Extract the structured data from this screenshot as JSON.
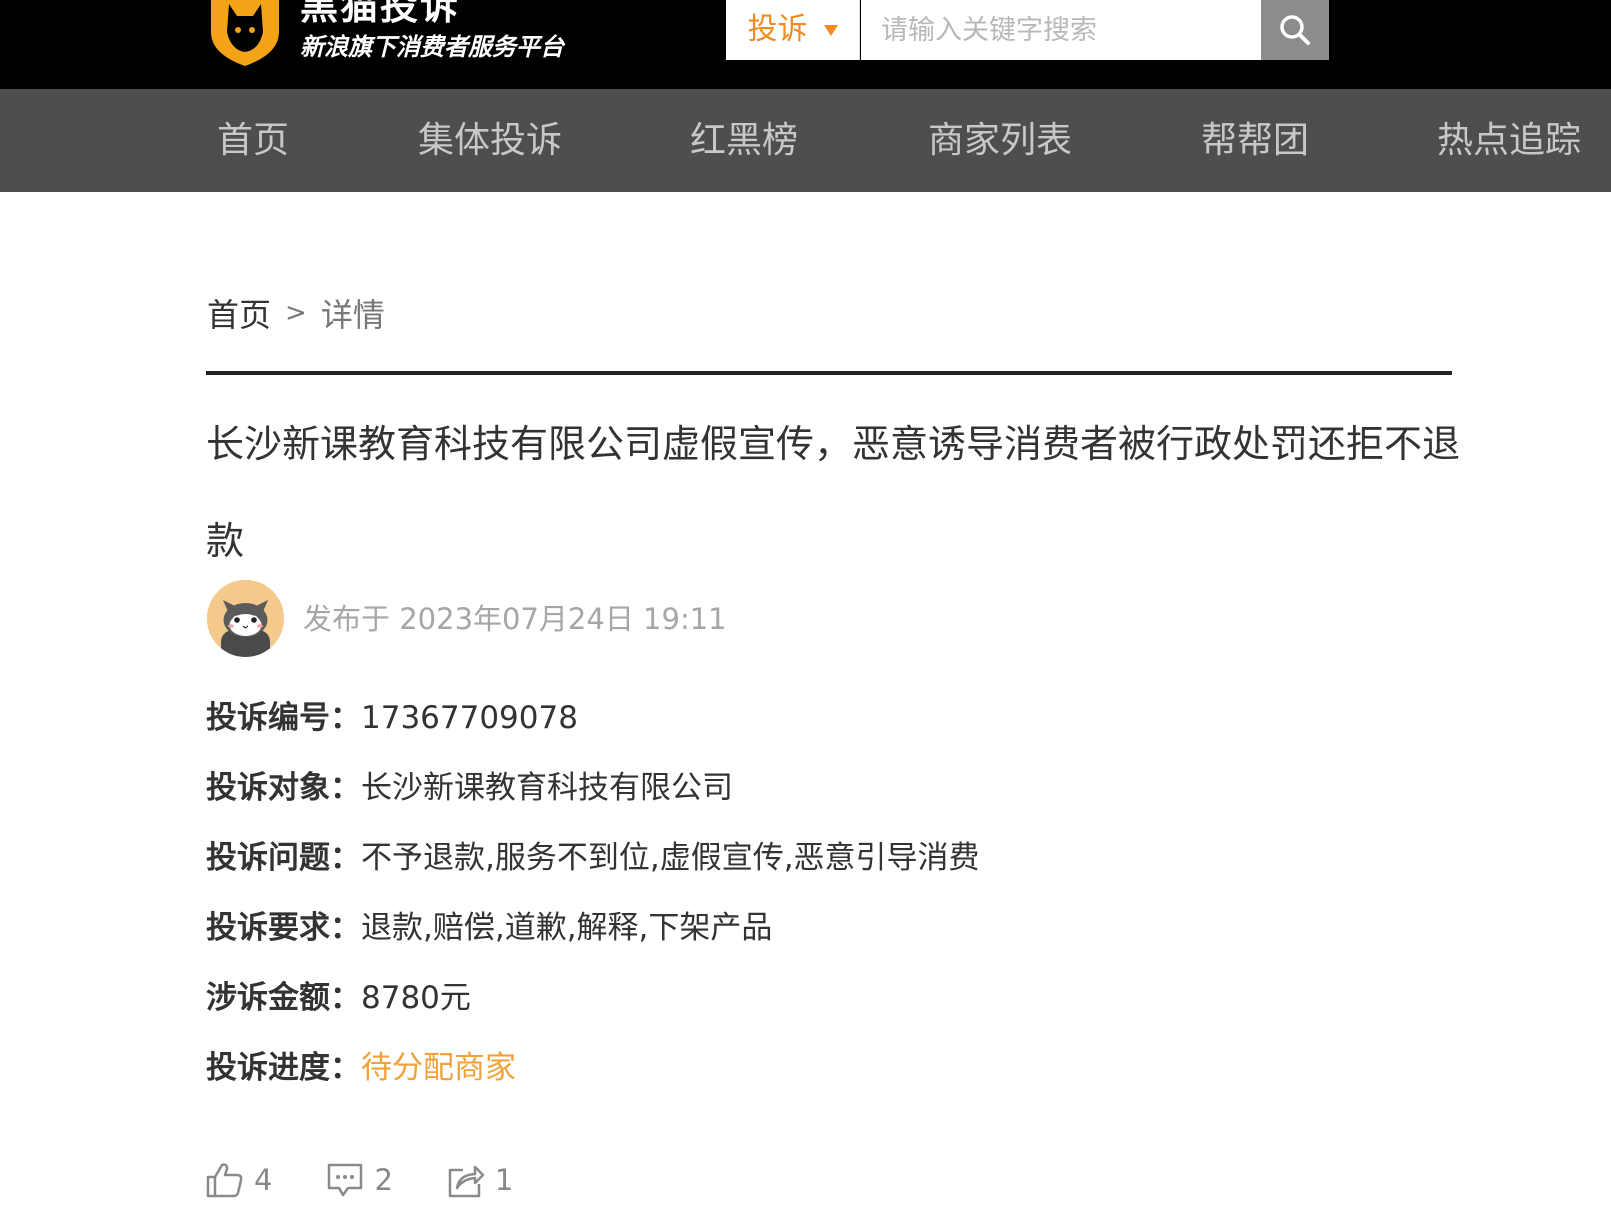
{
  "header": {
    "logo_title": "黑猫投诉",
    "logo_subtitle": "新浪旗下消费者服务平台",
    "search_type": "投诉",
    "search_placeholder": "请输入关键字搜索",
    "accent_color": "#f08c1e"
  },
  "nav": {
    "items": [
      {
        "label": "首页"
      },
      {
        "label": "集体投诉"
      },
      {
        "label": "红黑榜"
      },
      {
        "label": "商家列表"
      },
      {
        "label": "帮帮团"
      },
      {
        "label": "热点追踪"
      }
    ]
  },
  "breadcrumb": {
    "home": "首页",
    "separator": ">",
    "current": "详情"
  },
  "complaint": {
    "title": "长沙新课教育科技有限公司虚假宣传，恶意诱导消费者被行政处罚还拒不退款",
    "publish_time": "发布于 2023年07月24日 19:11",
    "fields": [
      {
        "label": "投诉编号：",
        "value": "17367709078"
      },
      {
        "label": "投诉对象：",
        "value": "长沙新课教育科技有限公司"
      },
      {
        "label": "投诉问题：",
        "value": "不予退款,服务不到位,虚假宣传,恶意引导消费"
      },
      {
        "label": "投诉要求：",
        "value": "退款,赔偿,道歉,解释,下架产品"
      },
      {
        "label": "涉诉金额：",
        "value": "8780元"
      },
      {
        "label": "投诉进度：",
        "value": "待分配商家"
      }
    ],
    "status_color": "#f0a23a"
  },
  "actions": {
    "likes": "4",
    "comments": "2",
    "shares": "1"
  },
  "icons": [
    "cat-logo-icon",
    "search-icon",
    "dropdown-caret-icon",
    "thumbs-up-icon",
    "comment-icon",
    "share-icon"
  ]
}
